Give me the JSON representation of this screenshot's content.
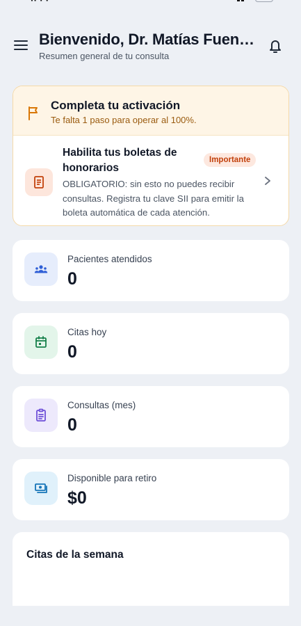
{
  "header": {
    "title": "Bienvenido, Dr. Matías Fuenzalida",
    "subtitle": "Resumen general de tu consulta"
  },
  "activation": {
    "title": "Completa tu activación",
    "subtitle": "Te falta 1 paso para operar al 100%.",
    "item": {
      "title": "Habilita tus boletas de honorarios",
      "badge": "Importante",
      "description": "OBLIGATORIO: sin esto no puedes recibir consultas. Registra tu clave SII para emitir la boleta automática de cada atención."
    }
  },
  "stats": [
    {
      "label": "Pacientes atendidos",
      "value": "0",
      "icon": "users-icon",
      "tile_color": "#e6edfc",
      "icon_color": "#2f5fd6"
    },
    {
      "label": "Citas hoy",
      "value": "0",
      "icon": "calendar-icon",
      "tile_color": "#e3f5ea",
      "icon_color": "#16804a"
    },
    {
      "label": "Consultas (mes)",
      "value": "0",
      "icon": "clipboard-icon",
      "tile_color": "#ede9fc",
      "icon_color": "#6d4fd8"
    },
    {
      "label": "Disponible para retiro",
      "value": "$0",
      "icon": "money-icon",
      "tile_color": "#e0f1fb",
      "icon_color": "#1574b8"
    }
  ],
  "week": {
    "title": "Citas de la semana"
  },
  "colors": {
    "background": "#edf0f5",
    "activation_head": "#fef5e6",
    "activation_accent": "#9a5b0f",
    "badge_bg": "#fde8df",
    "badge_text": "#c2410c"
  }
}
